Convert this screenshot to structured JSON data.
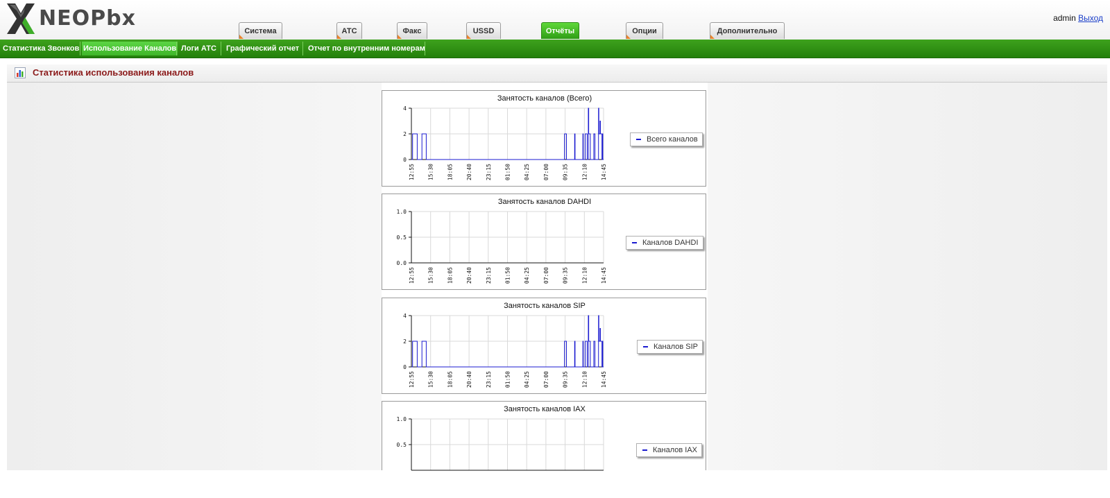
{
  "header": {
    "logo": {
      "text_main": "NEO",
      "text_end": "Pbx",
      "icon": "x-logo-icon"
    },
    "user": "admin",
    "logout_label": "Выход"
  },
  "tabs": [
    {
      "label": "Система",
      "active": false
    },
    {
      "label": "АТС",
      "active": false
    },
    {
      "label": "Факс",
      "active": false
    },
    {
      "label": "USSD",
      "active": false
    },
    {
      "label": "Отчёты",
      "active": true
    },
    {
      "label": "Опции",
      "active": false
    },
    {
      "label": "Дополнительно",
      "active": false
    }
  ],
  "subnav": [
    {
      "label": "Статистика Звонков",
      "active": false
    },
    {
      "label": "Использование Каналов",
      "active": true
    },
    {
      "label": "Логи АТС",
      "active": false
    },
    {
      "label": "Графический отчет",
      "active": false
    },
    {
      "label": "Отчет по внутренним номерам",
      "active": false
    }
  ],
  "page": {
    "title": "Статистика использования каналов",
    "icon": "bar-chart-icon"
  },
  "colors": {
    "accent_green": "#2f9d15",
    "title_red": "#8b1a1a",
    "series_blue": "#1a1ad0"
  },
  "chart_data": [
    {
      "type": "line",
      "title": "Занятость каналов (Всего)",
      "legend": "Всего каналов",
      "x_ticks": [
        "12:55",
        "15:30",
        "18:05",
        "20:40",
        "23:15",
        "01:50",
        "04:25",
        "07:00",
        "09:35",
        "12:10",
        "14:45"
      ],
      "y_ticks": [
        "0",
        "2",
        "4"
      ],
      "ylim": [
        0,
        4
      ],
      "grid": true,
      "legend_placement": "right",
      "series": [
        {
          "values": [
            [
              0,
              0
            ],
            [
              0.3,
              2
            ],
            [
              1.4,
              2
            ],
            [
              1.5,
              0
            ],
            [
              2.5,
              0
            ],
            [
              2.7,
              2
            ],
            [
              3.7,
              2
            ],
            [
              3.8,
              0
            ],
            [
              39.1,
              0
            ],
            [
              39.2,
              2
            ],
            [
              39.6,
              2
            ],
            [
              39.7,
              0
            ],
            [
              41.7,
              0
            ],
            [
              41.8,
              2
            ],
            [
              41.9,
              0
            ],
            [
              43.8,
              0
            ],
            [
              43.9,
              2
            ],
            [
              44.0,
              0
            ],
            [
              44.4,
              0
            ],
            [
              44.5,
              2
            ],
            [
              44.9,
              2
            ],
            [
              45.0,
              0
            ],
            [
              45.2,
              0
            ],
            [
              45.3,
              4
            ],
            [
              45.4,
              2
            ],
            [
              45.7,
              2
            ],
            [
              45.8,
              0
            ],
            [
              46.6,
              0
            ],
            [
              46.7,
              2
            ],
            [
              47.0,
              0
            ],
            [
              47.8,
              0
            ],
            [
              47.9,
              4
            ],
            [
              48.0,
              2
            ],
            [
              48.2,
              2
            ],
            [
              48.3,
              3
            ],
            [
              48.4,
              2
            ],
            [
              48.7,
              2
            ],
            [
              48.8,
              0
            ],
            [
              48.9,
              2
            ],
            [
              49.0,
              0
            ],
            [
              49.2,
              0
            ]
          ]
        }
      ]
    },
    {
      "type": "line",
      "title": "Занятость каналов DAHDI",
      "legend": "Каналов DAHDI",
      "x_ticks": [
        "12:55",
        "15:30",
        "18:05",
        "20:40",
        "23:15",
        "01:50",
        "04:25",
        "07:00",
        "09:35",
        "12:10",
        "14:45"
      ],
      "y_ticks": [
        "0.0",
        "0.5",
        "1.0"
      ],
      "ylim": [
        0,
        1
      ],
      "grid": true,
      "legend_placement": "right",
      "series": [
        {
          "values": []
        }
      ]
    },
    {
      "type": "line",
      "title": "Занятость каналов SIP",
      "legend": "Каналов SIP",
      "x_ticks": [
        "12:55",
        "15:30",
        "18:05",
        "20:40",
        "23:15",
        "01:50",
        "04:25",
        "07:00",
        "09:35",
        "12:10",
        "14:45"
      ],
      "y_ticks": [
        "0",
        "2",
        "4"
      ],
      "ylim": [
        0,
        4
      ],
      "grid": true,
      "legend_placement": "right",
      "series": [
        {
          "values": [
            [
              0,
              0
            ],
            [
              0.3,
              2
            ],
            [
              1.4,
              2
            ],
            [
              1.5,
              0
            ],
            [
              2.5,
              0
            ],
            [
              2.7,
              2
            ],
            [
              3.7,
              2
            ],
            [
              3.8,
              0
            ],
            [
              39.1,
              0
            ],
            [
              39.2,
              2
            ],
            [
              39.6,
              2
            ],
            [
              39.7,
              0
            ],
            [
              41.7,
              0
            ],
            [
              41.8,
              2
            ],
            [
              41.9,
              0
            ],
            [
              43.8,
              0
            ],
            [
              43.9,
              2
            ],
            [
              44.0,
              0
            ],
            [
              44.4,
              0
            ],
            [
              44.5,
              2
            ],
            [
              44.9,
              2
            ],
            [
              45.0,
              0
            ],
            [
              45.2,
              0
            ],
            [
              45.3,
              4
            ],
            [
              45.4,
              2
            ],
            [
              45.7,
              2
            ],
            [
              45.8,
              0
            ],
            [
              46.6,
              0
            ],
            [
              46.7,
              2
            ],
            [
              47.0,
              0
            ],
            [
              47.8,
              0
            ],
            [
              47.9,
              4
            ],
            [
              48.0,
              2
            ],
            [
              48.2,
              2
            ],
            [
              48.3,
              3
            ],
            [
              48.4,
              2
            ],
            [
              48.7,
              2
            ],
            [
              48.8,
              0
            ],
            [
              48.9,
              2
            ],
            [
              49.0,
              0
            ],
            [
              49.2,
              0
            ]
          ]
        }
      ]
    },
    {
      "type": "line",
      "title": "Занятость каналов IAX",
      "legend": "Каналов IAX",
      "x_ticks": [],
      "y_ticks": [
        "0.5",
        "1.0"
      ],
      "ylim": [
        0,
        1
      ],
      "grid": true,
      "legend_placement": "right",
      "series": [
        {
          "values": []
        }
      ]
    }
  ]
}
